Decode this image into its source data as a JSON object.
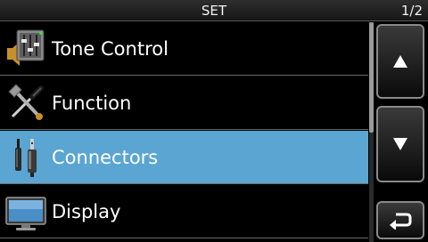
{
  "header": {
    "title": "SET",
    "page_indicator": "1/2"
  },
  "menu": {
    "items": [
      {
        "label": "Tone Control",
        "icon": "tone-control-icon",
        "selected": false
      },
      {
        "label": "Function",
        "icon": "function-tools-icon",
        "selected": false
      },
      {
        "label": "Connectors",
        "icon": "connector-plug-icon",
        "selected": true
      },
      {
        "label": "Display",
        "icon": "display-monitor-icon",
        "selected": false
      }
    ]
  },
  "scrollbar": {
    "position_fraction": 0.0,
    "visible_fraction": 0.5
  },
  "buttons": {
    "up_icon": "up-arrow-icon",
    "down_icon": "down-arrow-icon",
    "back_icon": "return-arrow-icon"
  },
  "colors": {
    "selected_row": "#5aa5d2",
    "background": "#000000"
  }
}
